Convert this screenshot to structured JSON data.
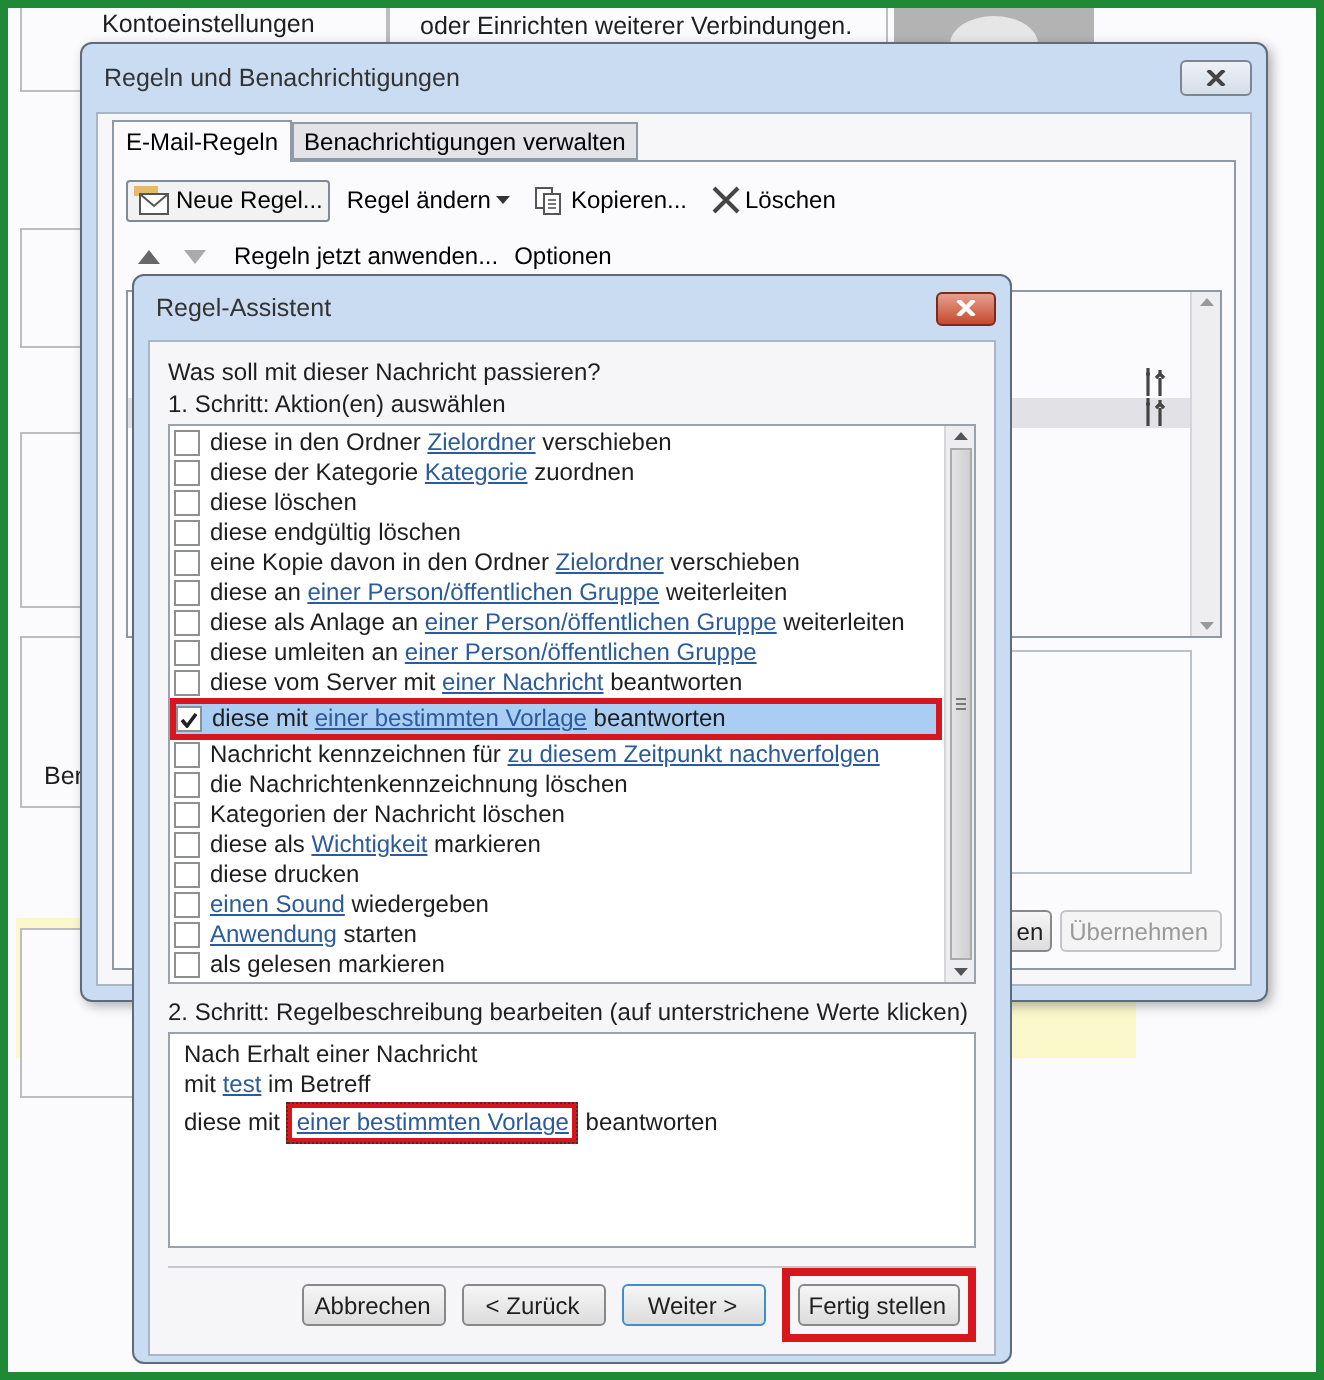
{
  "background_page": {
    "account_settings_label": "Kontoeinstellungen",
    "connections_text": "oder Einrichten weiterer Verbindungen.",
    "cut_label": "Ber"
  },
  "rules_dialog": {
    "title": "Regeln und Benachrichtigungen",
    "tabs": [
      {
        "label": "E-Mail-Regeln",
        "selected": true
      },
      {
        "label": "Benachrichtigungen verwalten",
        "selected": false
      }
    ],
    "toolbar": [
      {
        "kind": "new",
        "label": "Neue Regel..."
      },
      {
        "kind": "menu",
        "label": "Regel ändern"
      },
      {
        "kind": "copy",
        "label": "Kopieren..."
      },
      {
        "kind": "delete",
        "label": "Löschen"
      }
    ],
    "toolbar_2": {
      "apply_label": "Regeln jetzt anwenden...",
      "options_label": "Optionen"
    },
    "rules": [
      {
        "selected": false
      },
      {
        "selected": true
      }
    ],
    "buttons": [
      {
        "label": "en",
        "disabled": false
      },
      {
        "label": "Übernehmen",
        "disabled": true
      }
    ]
  },
  "rule_wizard": {
    "title": "Regel-Assistent",
    "question": "Was soll mit dieser Nachricht passieren?",
    "step1_label": "1. Schritt: Aktion(en) auswählen",
    "actions": [
      {
        "checked": false,
        "selected": false,
        "highlighted": false,
        "parts": [
          {
            "text": "diese in den Ordner ",
            "link": false
          },
          {
            "text": "Zielordner",
            "link": true
          },
          {
            "text": " verschieben",
            "link": false
          }
        ]
      },
      {
        "checked": false,
        "selected": false,
        "highlighted": false,
        "parts": [
          {
            "text": "diese der Kategorie ",
            "link": false
          },
          {
            "text": "Kategorie",
            "link": true
          },
          {
            "text": " zuordnen",
            "link": false
          }
        ]
      },
      {
        "checked": false,
        "selected": false,
        "highlighted": false,
        "parts": [
          {
            "text": "diese löschen",
            "link": false
          }
        ]
      },
      {
        "checked": false,
        "selected": false,
        "highlighted": false,
        "parts": [
          {
            "text": "diese endgültig löschen",
            "link": false
          }
        ]
      },
      {
        "checked": false,
        "selected": false,
        "highlighted": false,
        "parts": [
          {
            "text": "eine Kopie davon in den Ordner ",
            "link": false
          },
          {
            "text": "Zielordner",
            "link": true
          },
          {
            "text": " verschieben",
            "link": false
          }
        ]
      },
      {
        "checked": false,
        "selected": false,
        "highlighted": false,
        "parts": [
          {
            "text": "diese an ",
            "link": false
          },
          {
            "text": "einer Person/öffentlichen Gruppe",
            "link": true
          },
          {
            "text": " weiterleiten",
            "link": false
          }
        ]
      },
      {
        "checked": false,
        "selected": false,
        "highlighted": false,
        "parts": [
          {
            "text": "diese als Anlage an ",
            "link": false
          },
          {
            "text": "einer Person/öffentlichen Gruppe",
            "link": true
          },
          {
            "text": " weiterleiten",
            "link": false
          }
        ]
      },
      {
        "checked": false,
        "selected": false,
        "highlighted": false,
        "parts": [
          {
            "text": "diese umleiten an ",
            "link": false
          },
          {
            "text": "einer Person/öffentlichen Gruppe",
            "link": true
          }
        ]
      },
      {
        "checked": false,
        "selected": false,
        "highlighted": false,
        "parts": [
          {
            "text": "diese vom Server mit ",
            "link": false
          },
          {
            "text": "einer Nachricht",
            "link": true
          },
          {
            "text": " beantworten",
            "link": false
          }
        ]
      },
      {
        "checked": true,
        "selected": true,
        "highlighted": true,
        "parts": [
          {
            "text": "diese mit ",
            "link": false
          },
          {
            "text": "einer bestimmten Vorlage",
            "link": true
          },
          {
            "text": " beantworten",
            "link": false
          }
        ]
      },
      {
        "checked": false,
        "selected": false,
        "highlighted": false,
        "parts": [
          {
            "text": "Nachricht kennzeichnen für ",
            "link": false
          },
          {
            "text": "zu diesem Zeitpunkt nachverfolgen",
            "link": true
          }
        ]
      },
      {
        "checked": false,
        "selected": false,
        "highlighted": false,
        "parts": [
          {
            "text": "die Nachrichtenkennzeichnung löschen",
            "link": false
          }
        ]
      },
      {
        "checked": false,
        "selected": false,
        "highlighted": false,
        "parts": [
          {
            "text": "Kategorien der Nachricht löschen",
            "link": false
          }
        ]
      },
      {
        "checked": false,
        "selected": false,
        "highlighted": false,
        "parts": [
          {
            "text": "diese als ",
            "link": false
          },
          {
            "text": "Wichtigkeit",
            "link": true
          },
          {
            "text": " markieren",
            "link": false
          }
        ]
      },
      {
        "checked": false,
        "selected": false,
        "highlighted": false,
        "parts": [
          {
            "text": "diese drucken",
            "link": false
          }
        ]
      },
      {
        "checked": false,
        "selected": false,
        "highlighted": false,
        "parts": [
          {
            "text": "einen Sound",
            "link": true
          },
          {
            "text": " wiedergeben",
            "link": false
          }
        ]
      },
      {
        "checked": false,
        "selected": false,
        "highlighted": false,
        "parts": [
          {
            "text": "Anwendung",
            "link": true
          },
          {
            "text": " starten",
            "link": false
          }
        ]
      },
      {
        "checked": false,
        "selected": false,
        "highlighted": false,
        "parts": [
          {
            "text": "als gelesen markieren",
            "link": false
          }
        ]
      }
    ],
    "step2_label": "2. Schritt: Regelbeschreibung bearbeiten (auf unterstrichene Werte klicken)",
    "description": [
      {
        "parts": [
          {
            "text": "Nach Erhalt einer Nachricht",
            "link": false
          }
        ]
      },
      {
        "parts": [
          {
            "text": "mit ",
            "link": false
          },
          {
            "text": "test",
            "link": true
          },
          {
            "text": " im Betreff",
            "link": false
          }
        ]
      },
      {
        "parts": [
          {
            "text": "diese mit ",
            "link": false
          },
          {
            "text": "einer bestimmten Vorlage",
            "link": true,
            "focused": true,
            "highlighted": true
          },
          {
            "text": " beantworten",
            "link": false
          }
        ]
      }
    ],
    "buttons": [
      {
        "label": "Abbrechen",
        "kind": "normal",
        "highlighted": false
      },
      {
        "label": "< Zurück",
        "kind": "normal",
        "highlighted": false
      },
      {
        "label": "Weiter >",
        "kind": "default",
        "highlighted": false
      },
      {
        "label": "Fertig stellen",
        "kind": "normal",
        "highlighted": true
      }
    ]
  }
}
